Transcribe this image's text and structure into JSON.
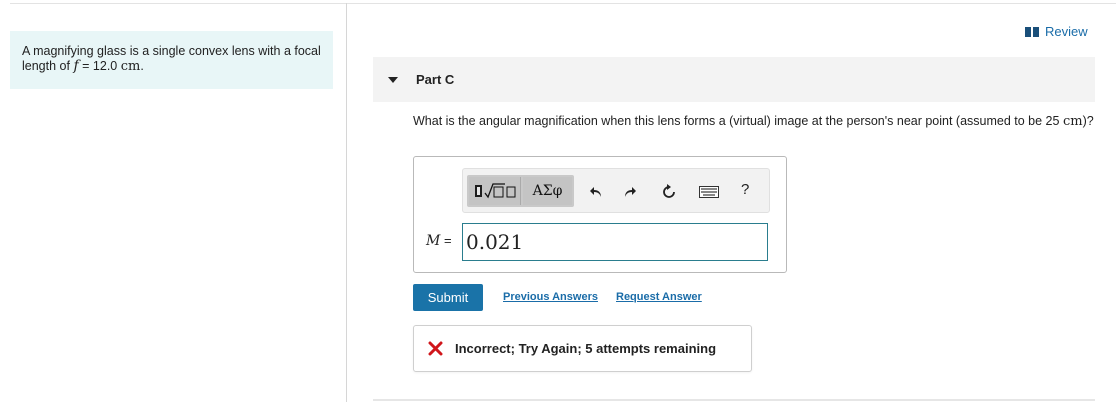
{
  "problem": {
    "text_before": "A magnifying glass is a single convex lens with a focal length of",
    "variable": "f",
    "equals": "=",
    "value": "12.0",
    "unit": "cm",
    "period": "."
  },
  "review": {
    "label": "Review",
    "icon": "book-icon"
  },
  "part": {
    "title": "Part C",
    "icon": "caret-down-icon"
  },
  "question": {
    "text": "What is the angular magnification when this lens forms a (virtual) image at the person's near point (assumed to be 25",
    "unit": "cm",
    "suffix": ")?"
  },
  "toolbar": {
    "symbols_label": "ΑΣφ",
    "help_label": "?",
    "icons": [
      "templates-icon",
      "undo-icon",
      "redo-icon",
      "reset-icon",
      "keyboard-icon",
      "help-icon"
    ]
  },
  "answer": {
    "variable": "M",
    "equals": "=",
    "value": "0.021"
  },
  "actions": {
    "submit_label": "Submit",
    "previous_answers_label": "Previous Answers",
    "request_answer_label": "Request Answer"
  },
  "feedback": {
    "text": "Incorrect; Try Again; 5 attempts remaining",
    "icon": "x-icon"
  },
  "colors": {
    "accent": "#1a73a8",
    "link": "#1a6ca8",
    "problem_bg": "#e8f6f7",
    "error": "#d0161b",
    "input_border": "#2a7d8e"
  }
}
